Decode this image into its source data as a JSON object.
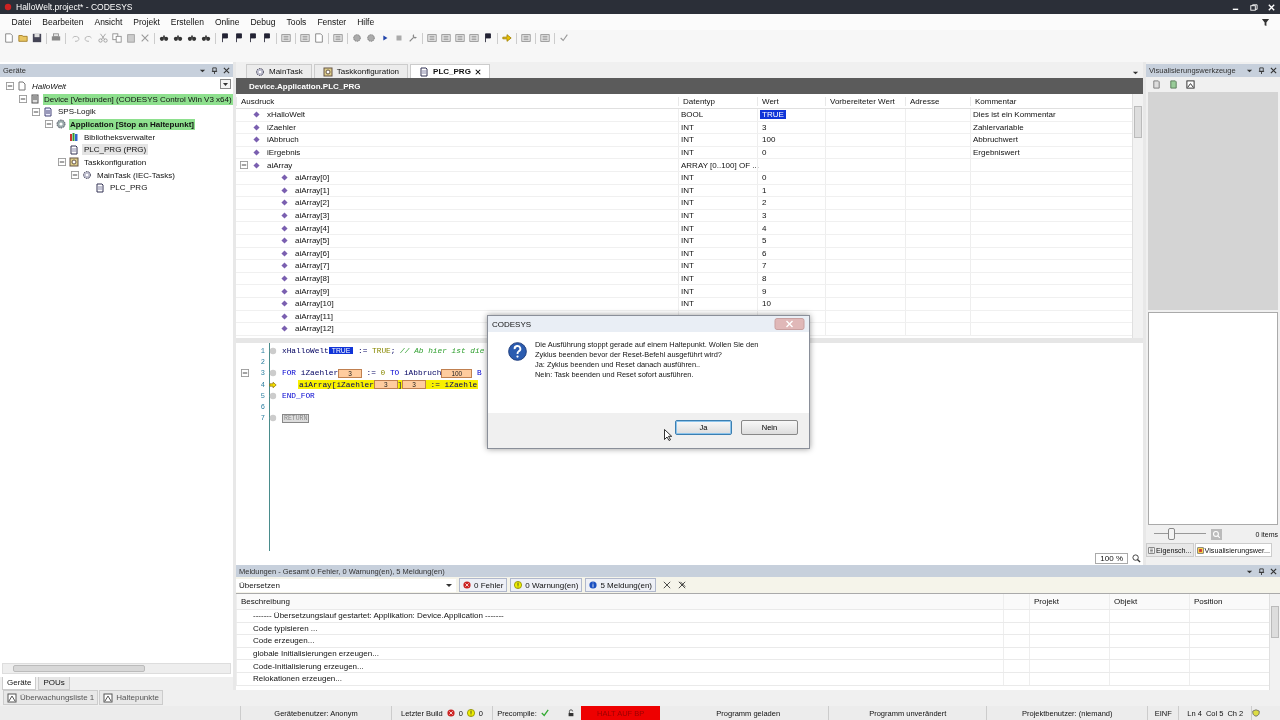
{
  "window": {
    "title": "HalloWelt.project* - CODESYS"
  },
  "menu": [
    "Datei",
    "Bearbeiten",
    "Ansicht",
    "Projekt",
    "Erstellen",
    "Online",
    "Debug",
    "Tools",
    "Fenster",
    "Hilfe"
  ],
  "devices_panel": {
    "title": "Geräte",
    "tree": [
      {
        "label": "HalloWelt",
        "kind": "project",
        "expanded": true,
        "highlighted": false,
        "selected": false,
        "children": [
          {
            "label": "Device [Verbunden] (CODESYS Control Win V3 x64)",
            "kind": "device",
            "expanded": true,
            "highlighted": true,
            "selected": false,
            "children": [
              {
                "label": "SPS-Logik",
                "kind": "plc",
                "expanded": true,
                "highlighted": false,
                "selected": false,
                "children": [
                  {
                    "label": "Application [Stop an Haltepunkt]",
                    "kind": "application",
                    "expanded": true,
                    "highlighted": true,
                    "selected": false,
                    "children": [
                      {
                        "label": "Bibliotheksverwalter",
                        "kind": "library",
                        "highlighted": false,
                        "selected": false
                      },
                      {
                        "label": "PLC_PRG (PRG)",
                        "kind": "pou",
                        "highlighted": false,
                        "selected": true
                      },
                      {
                        "label": "Taskkonfiguration",
                        "kind": "taskconfig",
                        "expanded": true,
                        "highlighted": false,
                        "selected": false,
                        "children": [
                          {
                            "label": "MainTask (IEC-Tasks)",
                            "kind": "task",
                            "expanded": true,
                            "highlighted": false,
                            "selected": false,
                            "children": [
                              {
                                "label": "PLC_PRG",
                                "kind": "call",
                                "highlighted": false,
                                "selected": false
                              }
                            ]
                          }
                        ]
                      }
                    ]
                  }
                ]
              }
            ]
          }
        ]
      }
    ],
    "tabs": [
      {
        "label": "Geräte",
        "selected": true
      },
      {
        "label": "POUs",
        "selected": false
      }
    ]
  },
  "editor_tabs": [
    {
      "label": "MainTask",
      "kind": "task",
      "selected": false
    },
    {
      "label": "Taskkonfiguration",
      "kind": "taskconfig",
      "selected": false
    },
    {
      "label": "PLC_PRG",
      "kind": "pou",
      "selected": true
    }
  ],
  "editor": {
    "path": "Device.Application.PLC_PRG",
    "columns": [
      "Ausdruck",
      "Datentyp",
      "Wert",
      "Vorbereiteter Wert",
      "Adresse",
      "Kommentar"
    ],
    "rows": [
      {
        "name": "xHalloWelt",
        "type": "BOOL",
        "value": "TRUE",
        "comment": "Dies ist ein Kommentar",
        "selected": true
      },
      {
        "name": "iZaehler",
        "type": "INT",
        "value": "3",
        "comment": "Zahlervariable",
        "selected": false
      },
      {
        "name": "iAbbruch",
        "type": "INT",
        "value": "100",
        "comment": "Abbruchwert",
        "selected": false
      },
      {
        "name": "iErgebnis",
        "type": "INT",
        "value": "0",
        "comment": "Ergebniswert",
        "selected": false
      },
      {
        "name": "aiArray",
        "type": "ARRAY [0..100] OF ...",
        "selected": false,
        "expanded": true,
        "children": [
          {
            "name": "aiArray[0]",
            "type": "INT",
            "value": "0",
            "selected": false
          },
          {
            "name": "aiArray[1]",
            "type": "INT",
            "value": "1",
            "selected": false
          },
          {
            "name": "aiArray[2]",
            "type": "INT",
            "value": "2",
            "selected": false
          },
          {
            "name": "aiArray[3]",
            "type": "INT",
            "value": "3",
            "selected": false
          },
          {
            "name": "aiArray[4]",
            "type": "INT",
            "value": "4",
            "selected": false
          },
          {
            "name": "aiArray[5]",
            "type": "INT",
            "value": "5",
            "selected": false
          },
          {
            "name": "aiArray[6]",
            "type": "INT",
            "value": "6",
            "selected": false
          },
          {
            "name": "aiArray[7]",
            "type": "INT",
            "value": "7",
            "selected": false
          },
          {
            "name": "aiArray[8]",
            "type": "INT",
            "value": "8",
            "selected": false
          },
          {
            "name": "aiArray[9]",
            "type": "INT",
            "value": "9",
            "selected": false
          },
          {
            "name": "aiArray[10]",
            "type": "INT",
            "value": "10",
            "selected": false
          },
          {
            "name": "aiArray[11]",
            "selected": false
          },
          {
            "name": "aiArray[12]",
            "selected": false
          }
        ]
      }
    ],
    "code": [
      {
        "number": "1",
        "kind": "dot",
        "fold": false,
        "current": false,
        "indented": false,
        "segments": [
          {
            "kind": "ident",
            "text": "xHalloWelt"
          },
          {
            "kind": "bool-value",
            "text": "TRUE"
          },
          {
            "kind": "op",
            "text": " := "
          },
          {
            "kind": "literal",
            "text": "TRUE"
          },
          {
            "kind": "op",
            "text": "; "
          },
          {
            "kind": "comment",
            "text": "// Ab hier ist die"
          }
        ]
      },
      {
        "number": "2",
        "fold": false
      },
      {
        "number": "3",
        "kind": "dot",
        "fold": true,
        "current": false,
        "indented": false,
        "segments": [
          {
            "kind": "keyword",
            "text": "FOR"
          },
          {
            "kind": "ident",
            "text": " iZaehler"
          },
          {
            "kind": "value",
            "text": "3"
          },
          {
            "kind": "op",
            "text": " := "
          },
          {
            "kind": "literal",
            "text": "0"
          },
          {
            "kind": "keyword",
            "text": " TO"
          },
          {
            "kind": "ident",
            "text": " iAbbruch"
          },
          {
            "kind": "value",
            "text": "100"
          },
          {
            "kind": "keyword",
            "text": " B"
          }
        ]
      },
      {
        "number": "4",
        "kind": "arrow",
        "fold": false,
        "current": true,
        "indented": true,
        "segments": [
          {
            "kind": "ident",
            "text": "aiArray[iZaehler"
          },
          {
            "kind": "value",
            "text": "3"
          },
          {
            "kind": "ident",
            "text": "]"
          },
          {
            "kind": "value",
            "text": "3"
          },
          {
            "kind": "op",
            "text": " := "
          },
          {
            "kind": "ident",
            "text": "iZaehle"
          }
        ]
      },
      {
        "number": "5",
        "kind": "dot",
        "fold": false,
        "current": false,
        "indented": false,
        "segments": [
          {
            "kind": "keyword",
            "text": "END_FOR"
          }
        ]
      },
      {
        "number": "6",
        "fold": false
      },
      {
        "number": "7",
        "kind": "dot",
        "fold": false,
        "current": false,
        "indented": false,
        "segments": [
          {
            "kind": "boxed",
            "text": "RETURN"
          }
        ]
      }
    ],
    "zoom": "100 %"
  },
  "visualization_panel": {
    "title": "Visualisierungswerkzeuge",
    "slider": {
      "level": 0.3
    },
    "count": "0 items",
    "tabs": [
      {
        "label": "Eigensch...",
        "kind": "properties",
        "selected": false
      },
      {
        "label": "Visualisierungswer...",
        "kind": "visualization",
        "selected": true
      }
    ]
  },
  "messages": {
    "title": "Meldungen - Gesamt 0 Fehler, 0 Warnung(en), 5 Meldung(en)",
    "category": "Übersetzen",
    "filters": [
      {
        "kind": "error",
        "label": "0 Fehler"
      },
      {
        "kind": "warning",
        "label": "0 Warnung(en)"
      },
      {
        "kind": "info",
        "label": "5 Meldung(en)"
      }
    ],
    "columns": [
      "Beschreibung",
      "Projekt",
      "Objekt",
      "Position"
    ],
    "rows": [
      "------- Übersetzungslauf gestartet: Applikation: Device.Application -------",
      "Code typisieren ...",
      "Code erzeugen...",
      "globale Initialisierungen erzeugen...",
      "Code-Initialisierung erzeugen...",
      "Relokationen erzeugen..."
    ]
  },
  "bottom_tabs": [
    {
      "label": "Überwachungsliste 1",
      "selected": false
    },
    {
      "label": "Haltepunkte",
      "selected": false
    }
  ],
  "status_bar": {
    "user": "Gerätebenutzer: Anonym",
    "build_label": "Letzter Build",
    "build_errors": "0",
    "build_warnings": "0",
    "precompile": "Precompile:",
    "precompile_ok": true,
    "run_state": "HALT AUF BP",
    "program_state": "Programm geladen",
    "change_state": "Programm unverändert",
    "project_user": "Projektbenutzer: (niemand)",
    "mode": "EINF",
    "line": "Ln 4",
    "column": "Col 5",
    "char": "Ch 2"
  },
  "dialog": {
    "title": "CODESYS",
    "message": [
      "Die Ausführung stoppt gerade auf einem Haltepunkt. Wollen Sie den",
      "Zyklus beenden bevor der Reset-Befehl ausgeführt wird?",
      "Ja: Zyklus beenden und Reset danach ausführen..",
      "Nein: Task beenden und Reset sofort ausführen."
    ],
    "buttons": [
      {
        "label": "Ja",
        "default": true
      },
      {
        "label": "Nein",
        "default": false
      }
    ]
  }
}
